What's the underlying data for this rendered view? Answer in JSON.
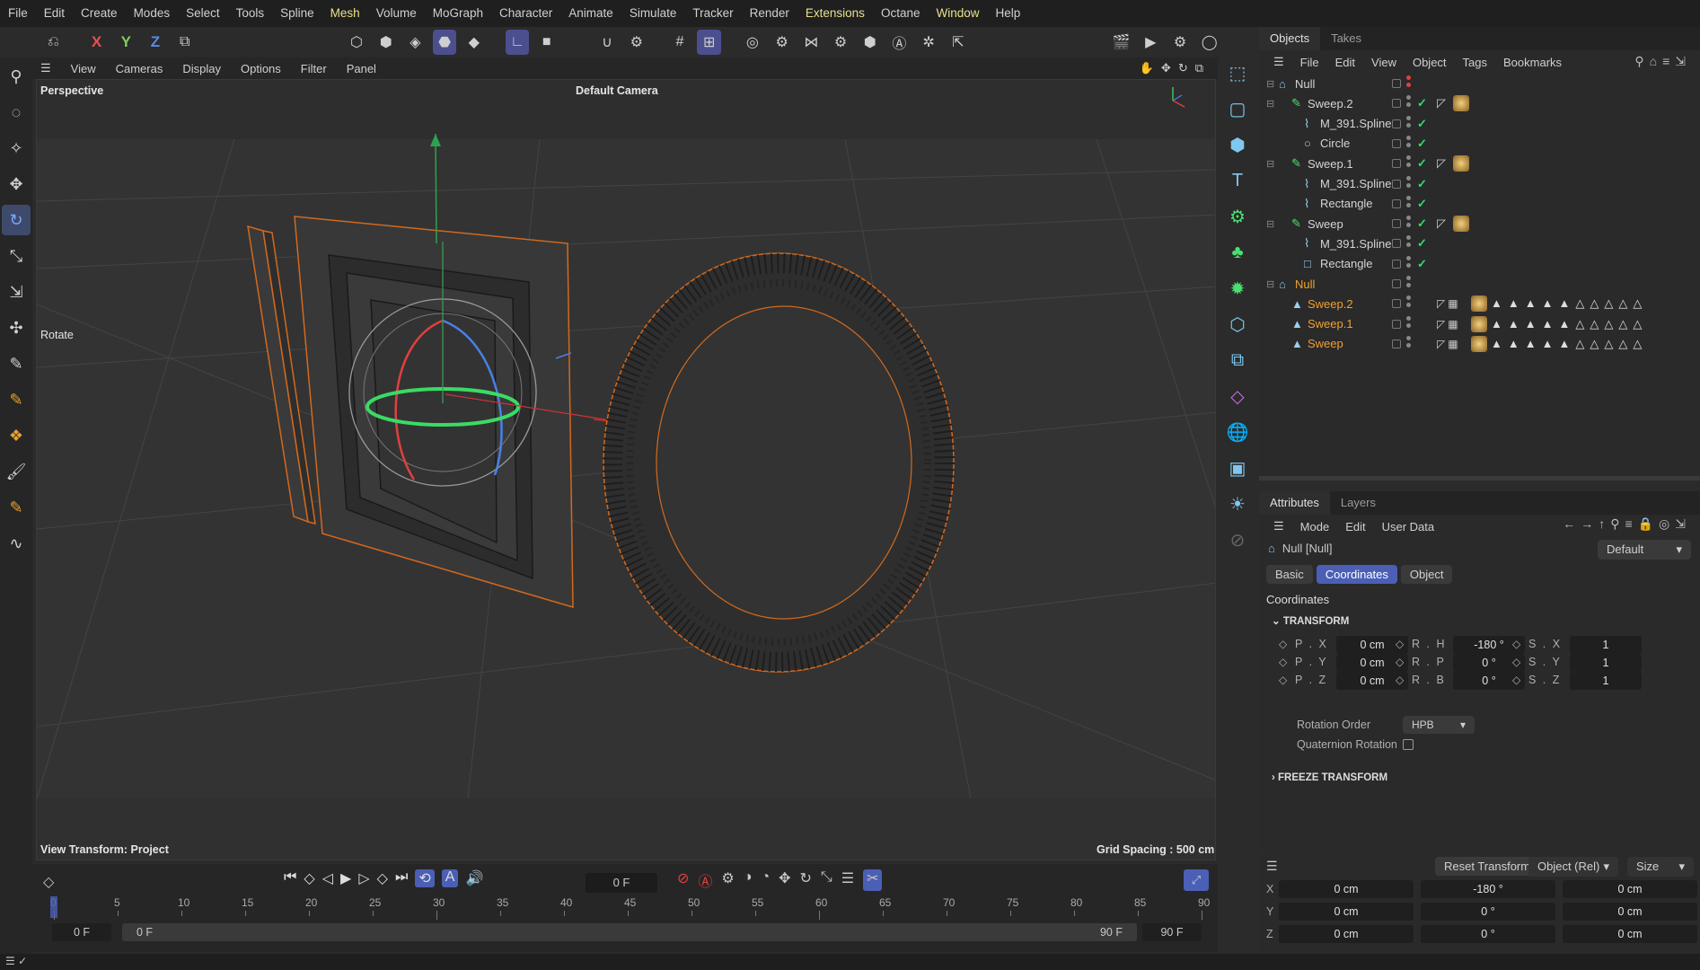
{
  "menubar": [
    "File",
    "Edit",
    "Create",
    "Modes",
    "Select",
    "Tools",
    "Spline",
    "Mesh",
    "Volume",
    "MoGraph",
    "Character",
    "Animate",
    "Simulate",
    "Tracker",
    "Render",
    "Extensions",
    "Octane",
    "Window",
    "Help"
  ],
  "menubar_highlight": [
    "Mesh",
    "Extensions",
    "Window"
  ],
  "toolbar": {
    "axis_x": "X",
    "axis_y": "Y",
    "axis_z": "Z"
  },
  "viewport_menu": [
    "View",
    "Cameras",
    "Display",
    "Options",
    "Filter",
    "Panel"
  ],
  "viewport": {
    "view_name": "Perspective",
    "camera": "Default Camera",
    "tool_label": "Rotate",
    "view_transform": "View Transform: Project",
    "grid_spacing": "Grid Spacing : 500 cm"
  },
  "objects_panel": {
    "tabs": [
      "Objects",
      "Takes"
    ],
    "menu": [
      "File",
      "Edit",
      "View",
      "Object",
      "Tags",
      "Bookmarks"
    ],
    "tree": [
      {
        "name": "Null",
        "depth": 0,
        "type": "null",
        "selected": false
      },
      {
        "name": "Sweep.2",
        "depth": 1,
        "type": "sweep",
        "selected": false
      },
      {
        "name": "M_391.Spline",
        "depth": 2,
        "type": "spline",
        "selected": false
      },
      {
        "name": "Circle",
        "depth": 2,
        "type": "circle",
        "selected": false
      },
      {
        "name": "Sweep.1",
        "depth": 1,
        "type": "sweep",
        "selected": false
      },
      {
        "name": "M_391.Spline",
        "depth": 2,
        "type": "spline",
        "selected": false
      },
      {
        "name": "Rectangle",
        "depth": 2,
        "type": "spline",
        "selected": false
      },
      {
        "name": "Sweep",
        "depth": 1,
        "type": "sweep",
        "selected": false
      },
      {
        "name": "M_391.Spline",
        "depth": 2,
        "type": "spline",
        "selected": false
      },
      {
        "name": "Rectangle",
        "depth": 2,
        "type": "rectangle",
        "selected": false
      },
      {
        "name": "Null",
        "depth": 0,
        "type": "null",
        "selected": true
      },
      {
        "name": "Sweep.2",
        "depth": 1,
        "type": "poly",
        "selected": true
      },
      {
        "name": "Sweep.1",
        "depth": 1,
        "type": "poly",
        "selected": true
      },
      {
        "name": "Sweep",
        "depth": 1,
        "type": "poly",
        "selected": true
      }
    ]
  },
  "attributes": {
    "tabs": [
      "Attributes",
      "Layers"
    ],
    "menu": [
      "Mode",
      "Edit",
      "User Data"
    ],
    "object_name": "Null [Null]",
    "preset": "Default",
    "subtabs": [
      "Basic",
      "Coordinates",
      "Object"
    ],
    "active_subtab": "Coordinates",
    "section": "Coordinates",
    "group": "TRANSFORM",
    "fields": [
      {
        "label": "P . X",
        "value": "0 cm"
      },
      {
        "label": "R . H",
        "value": "-180 °"
      },
      {
        "label": "S . X",
        "value": "1"
      },
      {
        "label": "P . Y",
        "value": "0 cm"
      },
      {
        "label": "R . P",
        "value": "0 °"
      },
      {
        "label": "S . Y",
        "value": "1"
      },
      {
        "label": "P . Z",
        "value": "0 cm"
      },
      {
        "label": "R . B",
        "value": "0 °"
      },
      {
        "label": "S . Z",
        "value": "1"
      }
    ],
    "rotation_order_label": "Rotation Order",
    "rotation_order": "HPB",
    "quaternion_label": "Quaternion Rotation",
    "freeze_group": "FREEZE TRANSFORM"
  },
  "coord_manager": {
    "reset_label": "Reset Transform",
    "mode": "Object (Rel)",
    "size_mode": "Size",
    "rows": [
      {
        "axis": "X",
        "p": "0 cm",
        "r": "-180 °",
        "s": "0 cm"
      },
      {
        "axis": "Y",
        "p": "0 cm",
        "r": "0 °",
        "s": "0 cm"
      },
      {
        "axis": "Z",
        "p": "0 cm",
        "r": "0 °",
        "s": "0 cm"
      }
    ]
  },
  "timeline": {
    "current_frame": "0 F",
    "ticks": [
      "0",
      "5",
      "10",
      "15",
      "20",
      "25",
      "30",
      "35",
      "40",
      "45",
      "50",
      "55",
      "60",
      "65",
      "70",
      "75",
      "80",
      "85",
      "90"
    ],
    "start": "0 F",
    "range_start": "0 F",
    "range_end": "90 F",
    "end": "90 F"
  },
  "colors": {
    "accent": "#4b5fb6",
    "selection": "#f0a030",
    "check": "#2ee06b",
    "wire_highlight": "#d2691e"
  }
}
